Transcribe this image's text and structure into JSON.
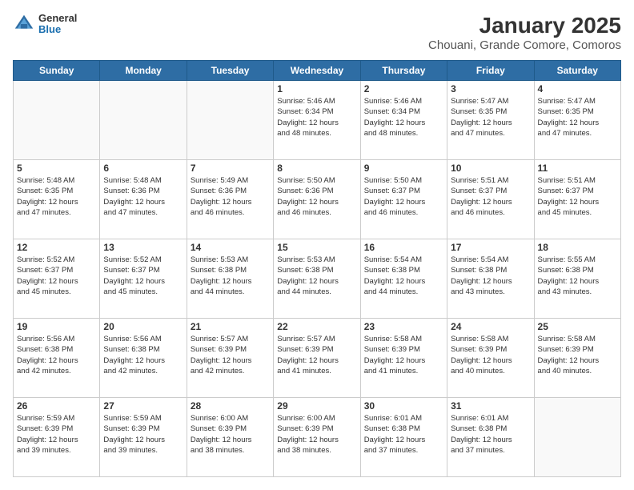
{
  "header": {
    "logo_general": "General",
    "logo_blue": "Blue",
    "title": "January 2025",
    "subtitle": "Chouani, Grande Comore, Comoros"
  },
  "days_of_week": [
    "Sunday",
    "Monday",
    "Tuesday",
    "Wednesday",
    "Thursday",
    "Friday",
    "Saturday"
  ],
  "weeks": [
    [
      {
        "day": "",
        "info": ""
      },
      {
        "day": "",
        "info": ""
      },
      {
        "day": "",
        "info": ""
      },
      {
        "day": "1",
        "info": "Sunrise: 5:46 AM\nSunset: 6:34 PM\nDaylight: 12 hours\nand 48 minutes."
      },
      {
        "day": "2",
        "info": "Sunrise: 5:46 AM\nSunset: 6:34 PM\nDaylight: 12 hours\nand 48 minutes."
      },
      {
        "day": "3",
        "info": "Sunrise: 5:47 AM\nSunset: 6:35 PM\nDaylight: 12 hours\nand 47 minutes."
      },
      {
        "day": "4",
        "info": "Sunrise: 5:47 AM\nSunset: 6:35 PM\nDaylight: 12 hours\nand 47 minutes."
      }
    ],
    [
      {
        "day": "5",
        "info": "Sunrise: 5:48 AM\nSunset: 6:35 PM\nDaylight: 12 hours\nand 47 minutes."
      },
      {
        "day": "6",
        "info": "Sunrise: 5:48 AM\nSunset: 6:36 PM\nDaylight: 12 hours\nand 47 minutes."
      },
      {
        "day": "7",
        "info": "Sunrise: 5:49 AM\nSunset: 6:36 PM\nDaylight: 12 hours\nand 46 minutes."
      },
      {
        "day": "8",
        "info": "Sunrise: 5:50 AM\nSunset: 6:36 PM\nDaylight: 12 hours\nand 46 minutes."
      },
      {
        "day": "9",
        "info": "Sunrise: 5:50 AM\nSunset: 6:37 PM\nDaylight: 12 hours\nand 46 minutes."
      },
      {
        "day": "10",
        "info": "Sunrise: 5:51 AM\nSunset: 6:37 PM\nDaylight: 12 hours\nand 46 minutes."
      },
      {
        "day": "11",
        "info": "Sunrise: 5:51 AM\nSunset: 6:37 PM\nDaylight: 12 hours\nand 45 minutes."
      }
    ],
    [
      {
        "day": "12",
        "info": "Sunrise: 5:52 AM\nSunset: 6:37 PM\nDaylight: 12 hours\nand 45 minutes."
      },
      {
        "day": "13",
        "info": "Sunrise: 5:52 AM\nSunset: 6:37 PM\nDaylight: 12 hours\nand 45 minutes."
      },
      {
        "day": "14",
        "info": "Sunrise: 5:53 AM\nSunset: 6:38 PM\nDaylight: 12 hours\nand 44 minutes."
      },
      {
        "day": "15",
        "info": "Sunrise: 5:53 AM\nSunset: 6:38 PM\nDaylight: 12 hours\nand 44 minutes."
      },
      {
        "day": "16",
        "info": "Sunrise: 5:54 AM\nSunset: 6:38 PM\nDaylight: 12 hours\nand 44 minutes."
      },
      {
        "day": "17",
        "info": "Sunrise: 5:54 AM\nSunset: 6:38 PM\nDaylight: 12 hours\nand 43 minutes."
      },
      {
        "day": "18",
        "info": "Sunrise: 5:55 AM\nSunset: 6:38 PM\nDaylight: 12 hours\nand 43 minutes."
      }
    ],
    [
      {
        "day": "19",
        "info": "Sunrise: 5:56 AM\nSunset: 6:38 PM\nDaylight: 12 hours\nand 42 minutes."
      },
      {
        "day": "20",
        "info": "Sunrise: 5:56 AM\nSunset: 6:38 PM\nDaylight: 12 hours\nand 42 minutes."
      },
      {
        "day": "21",
        "info": "Sunrise: 5:57 AM\nSunset: 6:39 PM\nDaylight: 12 hours\nand 42 minutes."
      },
      {
        "day": "22",
        "info": "Sunrise: 5:57 AM\nSunset: 6:39 PM\nDaylight: 12 hours\nand 41 minutes."
      },
      {
        "day": "23",
        "info": "Sunrise: 5:58 AM\nSunset: 6:39 PM\nDaylight: 12 hours\nand 41 minutes."
      },
      {
        "day": "24",
        "info": "Sunrise: 5:58 AM\nSunset: 6:39 PM\nDaylight: 12 hours\nand 40 minutes."
      },
      {
        "day": "25",
        "info": "Sunrise: 5:58 AM\nSunset: 6:39 PM\nDaylight: 12 hours\nand 40 minutes."
      }
    ],
    [
      {
        "day": "26",
        "info": "Sunrise: 5:59 AM\nSunset: 6:39 PM\nDaylight: 12 hours\nand 39 minutes."
      },
      {
        "day": "27",
        "info": "Sunrise: 5:59 AM\nSunset: 6:39 PM\nDaylight: 12 hours\nand 39 minutes."
      },
      {
        "day": "28",
        "info": "Sunrise: 6:00 AM\nSunset: 6:39 PM\nDaylight: 12 hours\nand 38 minutes."
      },
      {
        "day": "29",
        "info": "Sunrise: 6:00 AM\nSunset: 6:39 PM\nDaylight: 12 hours\nand 38 minutes."
      },
      {
        "day": "30",
        "info": "Sunrise: 6:01 AM\nSunset: 6:38 PM\nDaylight: 12 hours\nand 37 minutes."
      },
      {
        "day": "31",
        "info": "Sunrise: 6:01 AM\nSunset: 6:38 PM\nDaylight: 12 hours\nand 37 minutes."
      },
      {
        "day": "",
        "info": ""
      }
    ]
  ]
}
